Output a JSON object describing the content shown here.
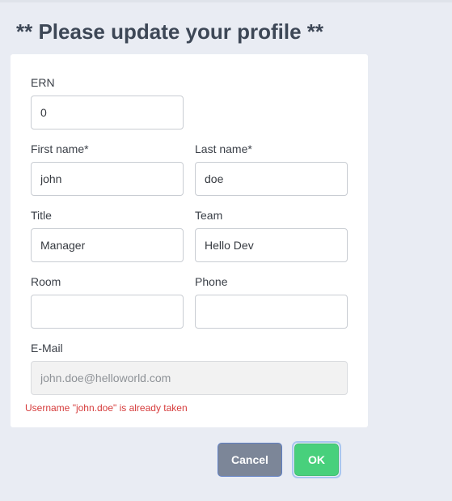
{
  "page": {
    "title": "** Please update your profile **"
  },
  "form": {
    "ern": {
      "label": "ERN",
      "value": "0"
    },
    "first_name": {
      "label": "First name*",
      "value": "john"
    },
    "last_name": {
      "label": "Last name*",
      "value": "doe"
    },
    "title": {
      "label": "Title",
      "value": "Manager"
    },
    "team": {
      "label": "Team",
      "value": "Hello Dev"
    },
    "room": {
      "label": "Room",
      "value": ""
    },
    "phone": {
      "label": "Phone",
      "value": ""
    },
    "email": {
      "label": "E-Mail",
      "value": "john.doe@helloworld.com",
      "disabled": true
    },
    "error_message": "Username \"john.doe\" is already taken"
  },
  "actions": {
    "cancel_label": "Cancel",
    "ok_label": "OK"
  },
  "colors": {
    "background": "#e9ecf3",
    "cancel_button": "#7c8698",
    "ok_button": "#48d07c",
    "error": "#d63c3c"
  }
}
